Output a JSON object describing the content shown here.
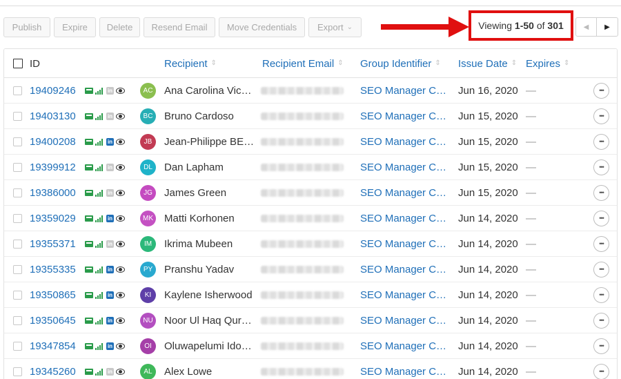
{
  "toolbar": {
    "publish": "Publish",
    "expire": "Expire",
    "delete": "Delete",
    "resend_email": "Resend Email",
    "move_credentials": "Move Credentials",
    "export": "Export"
  },
  "pagination": {
    "prefix": "Viewing",
    "range": "1-50",
    "of": "of",
    "total": "301"
  },
  "columns": {
    "id": "ID",
    "recipient": "Recipient",
    "recipient_email": "Recipient Email",
    "group_identifier": "Group Identifier",
    "issue_date": "Issue Date",
    "expires": "Expires"
  },
  "colors": {
    "link": "#1f6fb8",
    "annotation_red": "#e01010",
    "linkedin_active": "#1f6fb8",
    "linkedin_inactive": "#c9c9c9",
    "green_icon": "#2a9b4a"
  },
  "rows": [
    {
      "id": "19409246",
      "initials": "AC",
      "avatar_color": "#8bbf4f",
      "name": "Ana Carolina Vice…",
      "group": "SEO Manager Cer…",
      "issue_date": "Jun 16, 2020",
      "expires": "—",
      "linkedin": false
    },
    {
      "id": "19403130",
      "initials": "BC",
      "avatar_color": "#27aeb5",
      "name": "Bruno Cardoso",
      "group": "SEO Manager Cer…",
      "issue_date": "Jun 15, 2020",
      "expires": "—",
      "linkedin": false
    },
    {
      "id": "19400208",
      "initials": "JB",
      "avatar_color": "#c23b53",
      "name": "Jean-Philippe BE…",
      "group": "SEO Manager Cer…",
      "issue_date": "Jun 15, 2020",
      "expires": "—",
      "linkedin": true
    },
    {
      "id": "19399912",
      "initials": "DL",
      "avatar_color": "#1fb3c9",
      "name": "Dan Lapham",
      "group": "SEO Manager Cer…",
      "issue_date": "Jun 15, 2020",
      "expires": "—",
      "linkedin": false
    },
    {
      "id": "19386000",
      "initials": "JG",
      "avatar_color": "#c44bc0",
      "name": "James Green",
      "group": "SEO Manager Cer…",
      "issue_date": "Jun 15, 2020",
      "expires": "—",
      "linkedin": false
    },
    {
      "id": "19359029",
      "initials": "MK",
      "avatar_color": "#c451c2",
      "name": "Matti Korhonen",
      "group": "SEO Manager Cer…",
      "issue_date": "Jun 14, 2020",
      "expires": "—",
      "linkedin": true
    },
    {
      "id": "19355371",
      "initials": "IM",
      "avatar_color": "#2bb87a",
      "name": "Ikrima Mubeen",
      "group": "SEO Manager Cer…",
      "issue_date": "Jun 14, 2020",
      "expires": "—",
      "linkedin": false
    },
    {
      "id": "19355335",
      "initials": "PY",
      "avatar_color": "#29a9cf",
      "name": "Pranshu Yadav",
      "group": "SEO Manager Cer…",
      "issue_date": "Jun 14, 2020",
      "expires": "—",
      "linkedin": true
    },
    {
      "id": "19350865",
      "initials": "KI",
      "avatar_color": "#5e3fa8",
      "name": "Kaylene Isherwood",
      "group": "SEO Manager Cer…",
      "issue_date": "Jun 14, 2020",
      "expires": "—",
      "linkedin": true
    },
    {
      "id": "19350645",
      "initials": "NU",
      "avatar_color": "#b34fc0",
      "name": "Noor Ul Haq Qure…",
      "group": "SEO Manager Cer…",
      "issue_date": "Jun 14, 2020",
      "expires": "—",
      "linkedin": true
    },
    {
      "id": "19347854",
      "initials": "OI",
      "avatar_color": "#a53fa8",
      "name": "Oluwapelumi Ido…",
      "group": "SEO Manager Cer…",
      "issue_date": "Jun 14, 2020",
      "expires": "—",
      "linkedin": true
    },
    {
      "id": "19345260",
      "initials": "AL",
      "avatar_color": "#3fb85a",
      "name": "Alex Lowe",
      "group": "SEO Manager Cer…",
      "issue_date": "Jun 14, 2020",
      "expires": "—",
      "linkedin": false
    }
  ]
}
